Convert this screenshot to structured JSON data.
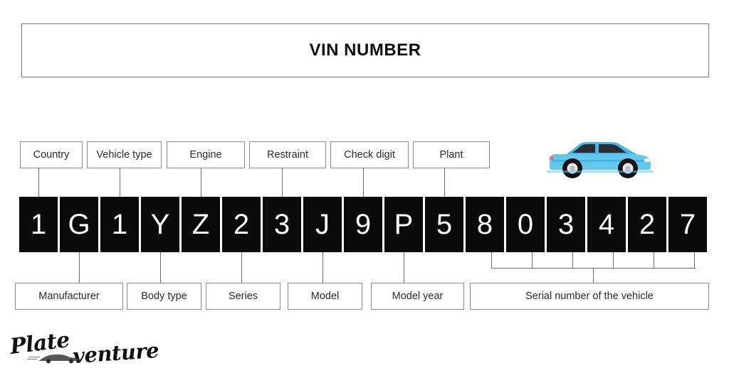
{
  "header": {
    "title": "VIN NUMBER"
  },
  "vin": {
    "full": "1G1YZ23J9P5803427",
    "characters": [
      "1",
      "G",
      "1",
      "Y",
      "Z",
      "2",
      "3",
      "J",
      "9",
      "P",
      "5",
      "8",
      "0",
      "3",
      "4",
      "2",
      "7"
    ]
  },
  "top_labels": [
    {
      "label": "Country",
      "char_index": 0
    },
    {
      "label": "Vehicle type",
      "char_index": 2
    },
    {
      "label": "Engine",
      "char_index": 4
    },
    {
      "label": "Restraint",
      "char_index": 6
    },
    {
      "label": "Check digit",
      "char_index": 8
    },
    {
      "label": "Plant",
      "char_index": 10
    }
  ],
  "bottom_labels": [
    {
      "label": "Manufacturer",
      "char_index": 1
    },
    {
      "label": "Body type",
      "char_index": 3
    },
    {
      "label": "Series",
      "char_index": 5
    },
    {
      "label": "Model",
      "char_index": 7
    },
    {
      "label": "Model year",
      "char_index": 9
    },
    {
      "label": "Serial number of the vehicle",
      "char_range": [
        11,
        16
      ]
    }
  ],
  "illustration": {
    "car_icon": "blue-hatchback-car",
    "body_color": "#63c7ee",
    "roof_color": "#4ab4e0",
    "window_color": "#2b2b33",
    "wheel_color": "#1a1a1a",
    "hub_color": "#e8e8e8"
  },
  "watermark": {
    "word_one": "Plate",
    "word_two": "venture",
    "car_icon": "car-silhouette-icon"
  },
  "colors": {
    "background": "#ffffff",
    "vin_cell_bg": "#0a0a0a",
    "vin_cell_text": "#ffffff",
    "box_border": "#8a8a8a",
    "connector": "#6e6e6e",
    "title_border": "#7a7a7a"
  }
}
